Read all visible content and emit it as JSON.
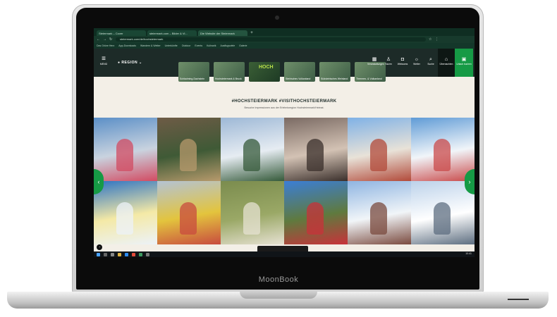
{
  "device": {
    "brand": "MoonBook"
  },
  "browser": {
    "tabs": [
      {
        "label": "Steiermark – Cover"
      },
      {
        "label": "steiermark.com – Bilder & Vi..."
      },
      {
        "label": "Die Website der Steiermark"
      }
    ],
    "new_tab": "+",
    "url": "steiermark.com/de/hochsteiermark",
    "bookmarks": [
      "Das Grüne Herz",
      "App-Downloads",
      "Wandern & Wetter",
      "Unterkünfte",
      "Outdoor",
      "Events",
      "Kulinarik",
      "Ausflugsziele",
      "Galerie"
    ]
  },
  "site": {
    "menu": {
      "icon": "hamburger-icon",
      "label": "MENÜ"
    },
    "region": {
      "label": "REGION",
      "icon": "chevron-down-icon"
    },
    "thumbs": [
      {
        "label": "Schladming-Dachstein"
      },
      {
        "label": "Hochsteiermark & Bruck"
      },
      {
        "label": "HOCH"
      },
      {
        "label": "Steirisches Vulkanland"
      },
      {
        "label": "Südsteirisches Weinland"
      },
      {
        "label": "Thermen- & Vulkanland"
      }
    ],
    "actions": [
      {
        "label": "Veranstaltungen",
        "icon": "calendar-icon"
      },
      {
        "label": "Touren",
        "icon": "hiker-icon"
      },
      {
        "label": "Webcams",
        "icon": "camera-icon"
      },
      {
        "label": "Wetter",
        "icon": "weather-icon"
      },
      {
        "label": "Suche",
        "icon": "search-icon"
      },
      {
        "label": "Übernachten",
        "icon": "bed-icon"
      },
      {
        "label": "Urlaub buchen",
        "icon": "suitcase-icon"
      }
    ]
  },
  "gallery": {
    "hashtag": "#HOCHSTEIERMARK #VISITHOCHSTEIERMARK",
    "subtitle": "Besuche Impressionen aus der Erlebnisregion Hochsteiermark/Heimat.",
    "tiles": [
      {
        "name": "parade-costumes",
        "colors": [
          "#5b8fc7",
          "#c9d3df",
          "#d24b62"
        ]
      },
      {
        "name": "market-stand-people",
        "colors": [
          "#6e5b46",
          "#3f5a36",
          "#b79a6c"
        ]
      },
      {
        "name": "snowy-church-tower",
        "colors": [
          "#9db8d6",
          "#e6ecf2",
          "#355a3a"
        ]
      },
      {
        "name": "group-selfie-indoor",
        "colors": [
          "#7a6a63",
          "#d3c2b4",
          "#3a2f2b"
        ]
      },
      {
        "name": "basilica-mariazell",
        "colors": [
          "#7fb1e6",
          "#e8e2d8",
          "#b24a3a"
        ]
      },
      {
        "name": "snow-skis",
        "colors": [
          "#5f9bd6",
          "#f1f5f9",
          "#c94a4a"
        ]
      },
      {
        "name": "skier-portrait",
        "colors": [
          "#2e74c4",
          "#f4e9a6",
          "#ecf2f8"
        ]
      },
      {
        "name": "carnival-costumes",
        "colors": [
          "#b4c3d4",
          "#e3c43d",
          "#c84b3f"
        ]
      },
      {
        "name": "25-on-grass",
        "colors": [
          "#7b8c4e",
          "#9aa866",
          "#e6e1d2"
        ]
      },
      {
        "name": "red-sculpture-village",
        "colors": [
          "#3b7ed6",
          "#5f7a3e",
          "#c8323a"
        ]
      },
      {
        "name": "snowshoe-hikers",
        "colors": [
          "#8fb5e2",
          "#f1f5f8",
          "#7a4a3e"
        ]
      },
      {
        "name": "snowy-mountain-hikers",
        "colors": [
          "#bcd2ea",
          "#ffffff",
          "#5d6e80"
        ]
      }
    ],
    "prev_icon": "chevron-left-icon",
    "next_icon": "chevron-right-icon"
  },
  "taskbar": {
    "clock": "10:41"
  }
}
